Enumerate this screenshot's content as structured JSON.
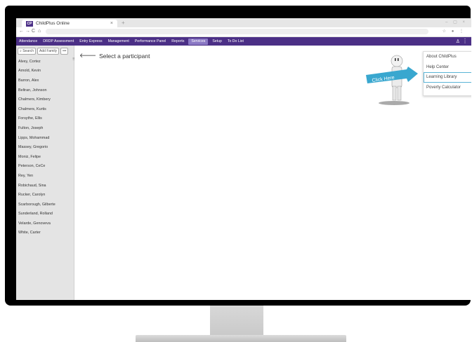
{
  "browser": {
    "tab_title": "ChildPlus Online",
    "tab_logo": "CP",
    "tab_close": "×",
    "new_tab": "+",
    "window_controls": "– ▢ ×",
    "nav": {
      "back": "←",
      "forward": "→",
      "reload": "C",
      "home": "⌂"
    },
    "omni_icons": "☆ ● ⋮"
  },
  "menu": {
    "items": [
      {
        "label": "Attendance"
      },
      {
        "label": "DRDP Assessment"
      },
      {
        "label": "Entry Express"
      },
      {
        "label": "Management"
      },
      {
        "label": "Performance Panel"
      },
      {
        "label": "Reports"
      },
      {
        "label": "Services",
        "active": true
      },
      {
        "label": "Setup"
      },
      {
        "label": "To Do List"
      }
    ],
    "user_icon": "♙",
    "more_icon": "⋮"
  },
  "sidebar": {
    "search_label": "Search",
    "search_icon": "⌕",
    "add_family_label": "Add Family",
    "more_label": "•••",
    "handle": "⠿",
    "participants": [
      "Alvey, Cortez",
      "Arnold, Kevin",
      "Barron, Alex",
      "Beltran, Johnson",
      "Chalmers, Kimbery",
      "Chalmers, Kurtis",
      "Forsythe, Ellis",
      "Fulton, Joseph",
      "Lipps, Mohammad",
      "Massey, Gregorio",
      "Moniz, Felipe",
      "Peterson, CeCe",
      "Rey, Yen",
      "Robichaud, Sina",
      "Rucker, Carolyn",
      "Scarborough, Gilberte",
      "Sunderland, Rolland",
      "Velarde, Genoveva",
      "White, Carter"
    ]
  },
  "main": {
    "prompt": "Select a participant",
    "arrow": "🡐"
  },
  "help_figure": {
    "sign_text": "Click Here"
  },
  "help_menu": {
    "items": [
      {
        "label": "About ChildPlus"
      },
      {
        "label": "Help Center"
      },
      {
        "label": "Learning Library",
        "highlighted": true
      },
      {
        "label": "Poverty Calculator"
      }
    ]
  },
  "colors": {
    "menu_bar": "#4b2f86",
    "active_menu": "#8a78c4",
    "highlight": "#5ab4d6",
    "sign": "#39a7cf"
  }
}
